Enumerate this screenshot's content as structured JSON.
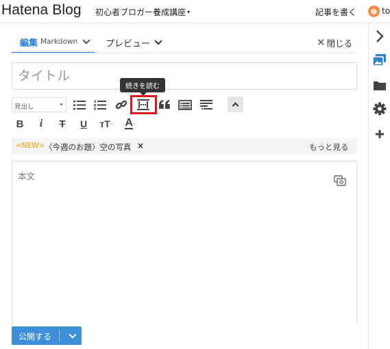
{
  "header": {
    "logo": "Hatena Blog",
    "blog_name": "初心者ブロガー養成講座",
    "blog_caret": "▾",
    "write_label": "記事を書く",
    "user_name": "to"
  },
  "tabs": {
    "edit_label": "編集",
    "edit_mode": "Markdown",
    "preview_label": "プレビュー",
    "close_label": "閉じる",
    "close_icon": "✕"
  },
  "title_input": {
    "placeholder": "タイトル",
    "value": ""
  },
  "toolbar": {
    "style_select_value": "見出し",
    "tooltip": "続きを読む",
    "buttons": [
      {
        "icon": "bullet-list-icon"
      },
      {
        "icon": "numbered-list-icon"
      },
      {
        "icon": "link-icon"
      },
      {
        "icon": "read-more-icon"
      },
      {
        "icon": "quote-icon"
      },
      {
        "icon": "table-icon"
      },
      {
        "icon": "footnote-icon"
      },
      {
        "icon": "collapse-toolbar-icon"
      }
    ],
    "format": {
      "bold": "B",
      "italic": "i",
      "strike": "T",
      "underline": "U",
      "size": "тT",
      "color": "A"
    },
    "highlight_color": "#d9191e"
  },
  "topic": {
    "new_badge": "<NEW>",
    "text": "〈今週のお題〉空の写真",
    "remove": "×",
    "more": "もっと見る",
    "badge_color": "#f5a300"
  },
  "body": {
    "placeholder": "本文"
  },
  "publish": {
    "label": "公開する",
    "color": "#3d8fd9"
  },
  "rail": {
    "items": [
      "expand-icon",
      "image-icon",
      "folder-icon",
      "gear-icon",
      "plus-icon"
    ]
  },
  "colors": {
    "accent": "#2980d8"
  }
}
